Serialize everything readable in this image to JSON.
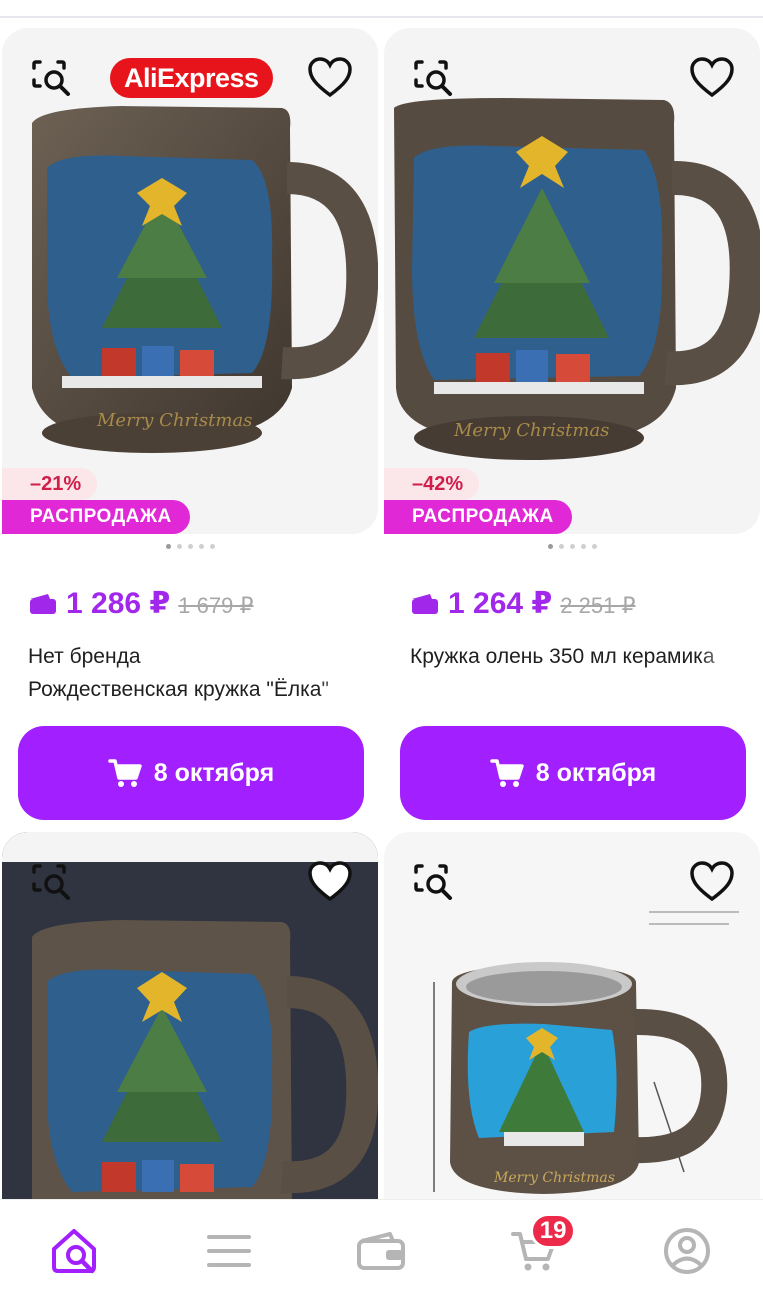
{
  "colors": {
    "accent": "#a21fff",
    "price": "#a128ea",
    "sale_badge": "#e028d6",
    "discount_text": "#d01f4a",
    "brand_badge": "#e8141c",
    "cart_badge": "#ee2a4a"
  },
  "products": [
    {
      "brand_badge": "AliExpress",
      "discount": "–21%",
      "sale_label": "РАСПРОДАЖА",
      "price": "1 286 ₽",
      "old_price": "1 679 ₽",
      "title_line1": "Нет бренда",
      "title_line2": "Рождественская кружка \"Ёлка\"",
      "delivery_label": "8 октября",
      "image_icon": "christmas-tree-mug-image"
    },
    {
      "discount": "–42%",
      "sale_label": "РАСПРОДАЖА",
      "price": "1 264 ₽",
      "old_price": "2 251 ₽",
      "title_line1": "Кружка олень 350 мл керамика",
      "delivery_label": "8 октября",
      "image_icon": "christmas-tree-mug-image"
    },
    {
      "image_icon": "christmas-tree-mug-image"
    },
    {
      "image_icon": "steel-christmas-mug-image"
    }
  ],
  "nav": {
    "items": [
      "home-search",
      "catalog",
      "wallet",
      "cart",
      "profile"
    ],
    "cart_count": "19"
  }
}
